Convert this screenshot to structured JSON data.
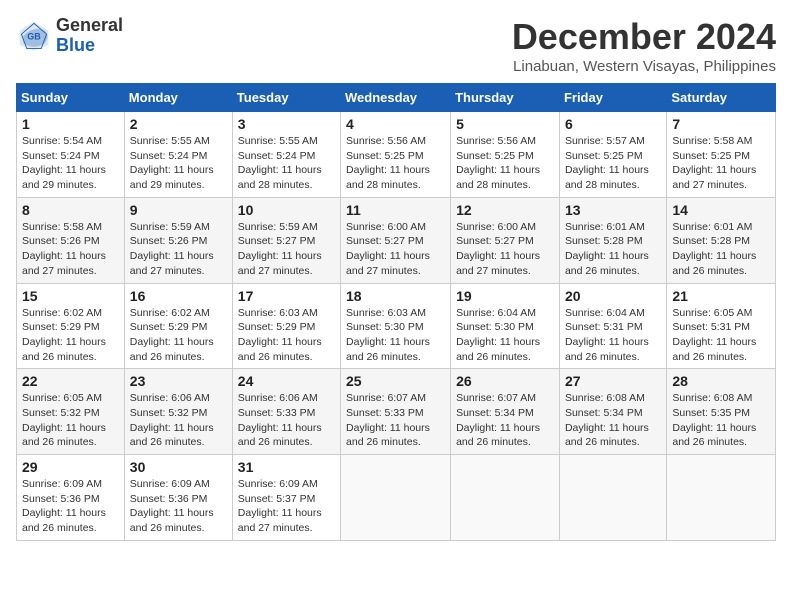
{
  "header": {
    "logo_general": "General",
    "logo_blue": "Blue",
    "month_year": "December 2024",
    "location": "Linabuan, Western Visayas, Philippines"
  },
  "weekdays": [
    "Sunday",
    "Monday",
    "Tuesday",
    "Wednesday",
    "Thursday",
    "Friday",
    "Saturday"
  ],
  "weeks": [
    [
      {
        "day": "1",
        "info": "Sunrise: 5:54 AM\nSunset: 5:24 PM\nDaylight: 11 hours\nand 29 minutes."
      },
      {
        "day": "2",
        "info": "Sunrise: 5:55 AM\nSunset: 5:24 PM\nDaylight: 11 hours\nand 29 minutes."
      },
      {
        "day": "3",
        "info": "Sunrise: 5:55 AM\nSunset: 5:24 PM\nDaylight: 11 hours\nand 28 minutes."
      },
      {
        "day": "4",
        "info": "Sunrise: 5:56 AM\nSunset: 5:25 PM\nDaylight: 11 hours\nand 28 minutes."
      },
      {
        "day": "5",
        "info": "Sunrise: 5:56 AM\nSunset: 5:25 PM\nDaylight: 11 hours\nand 28 minutes."
      },
      {
        "day": "6",
        "info": "Sunrise: 5:57 AM\nSunset: 5:25 PM\nDaylight: 11 hours\nand 28 minutes."
      },
      {
        "day": "7",
        "info": "Sunrise: 5:58 AM\nSunset: 5:25 PM\nDaylight: 11 hours\nand 27 minutes."
      }
    ],
    [
      {
        "day": "8",
        "info": "Sunrise: 5:58 AM\nSunset: 5:26 PM\nDaylight: 11 hours\nand 27 minutes."
      },
      {
        "day": "9",
        "info": "Sunrise: 5:59 AM\nSunset: 5:26 PM\nDaylight: 11 hours\nand 27 minutes."
      },
      {
        "day": "10",
        "info": "Sunrise: 5:59 AM\nSunset: 5:27 PM\nDaylight: 11 hours\nand 27 minutes."
      },
      {
        "day": "11",
        "info": "Sunrise: 6:00 AM\nSunset: 5:27 PM\nDaylight: 11 hours\nand 27 minutes."
      },
      {
        "day": "12",
        "info": "Sunrise: 6:00 AM\nSunset: 5:27 PM\nDaylight: 11 hours\nand 27 minutes."
      },
      {
        "day": "13",
        "info": "Sunrise: 6:01 AM\nSunset: 5:28 PM\nDaylight: 11 hours\nand 26 minutes."
      },
      {
        "day": "14",
        "info": "Sunrise: 6:01 AM\nSunset: 5:28 PM\nDaylight: 11 hours\nand 26 minutes."
      }
    ],
    [
      {
        "day": "15",
        "info": "Sunrise: 6:02 AM\nSunset: 5:29 PM\nDaylight: 11 hours\nand 26 minutes."
      },
      {
        "day": "16",
        "info": "Sunrise: 6:02 AM\nSunset: 5:29 PM\nDaylight: 11 hours\nand 26 minutes."
      },
      {
        "day": "17",
        "info": "Sunrise: 6:03 AM\nSunset: 5:29 PM\nDaylight: 11 hours\nand 26 minutes."
      },
      {
        "day": "18",
        "info": "Sunrise: 6:03 AM\nSunset: 5:30 PM\nDaylight: 11 hours\nand 26 minutes."
      },
      {
        "day": "19",
        "info": "Sunrise: 6:04 AM\nSunset: 5:30 PM\nDaylight: 11 hours\nand 26 minutes."
      },
      {
        "day": "20",
        "info": "Sunrise: 6:04 AM\nSunset: 5:31 PM\nDaylight: 11 hours\nand 26 minutes."
      },
      {
        "day": "21",
        "info": "Sunrise: 6:05 AM\nSunset: 5:31 PM\nDaylight: 11 hours\nand 26 minutes."
      }
    ],
    [
      {
        "day": "22",
        "info": "Sunrise: 6:05 AM\nSunset: 5:32 PM\nDaylight: 11 hours\nand 26 minutes."
      },
      {
        "day": "23",
        "info": "Sunrise: 6:06 AM\nSunset: 5:32 PM\nDaylight: 11 hours\nand 26 minutes."
      },
      {
        "day": "24",
        "info": "Sunrise: 6:06 AM\nSunset: 5:33 PM\nDaylight: 11 hours\nand 26 minutes."
      },
      {
        "day": "25",
        "info": "Sunrise: 6:07 AM\nSunset: 5:33 PM\nDaylight: 11 hours\nand 26 minutes."
      },
      {
        "day": "26",
        "info": "Sunrise: 6:07 AM\nSunset: 5:34 PM\nDaylight: 11 hours\nand 26 minutes."
      },
      {
        "day": "27",
        "info": "Sunrise: 6:08 AM\nSunset: 5:34 PM\nDaylight: 11 hours\nand 26 minutes."
      },
      {
        "day": "28",
        "info": "Sunrise: 6:08 AM\nSunset: 5:35 PM\nDaylight: 11 hours\nand 26 minutes."
      }
    ],
    [
      {
        "day": "29",
        "info": "Sunrise: 6:09 AM\nSunset: 5:36 PM\nDaylight: 11 hours\nand 26 minutes."
      },
      {
        "day": "30",
        "info": "Sunrise: 6:09 AM\nSunset: 5:36 PM\nDaylight: 11 hours\nand 26 minutes."
      },
      {
        "day": "31",
        "info": "Sunrise: 6:09 AM\nSunset: 5:37 PM\nDaylight: 11 hours\nand 27 minutes."
      },
      {
        "day": "",
        "info": ""
      },
      {
        "day": "",
        "info": ""
      },
      {
        "day": "",
        "info": ""
      },
      {
        "day": "",
        "info": ""
      }
    ]
  ]
}
